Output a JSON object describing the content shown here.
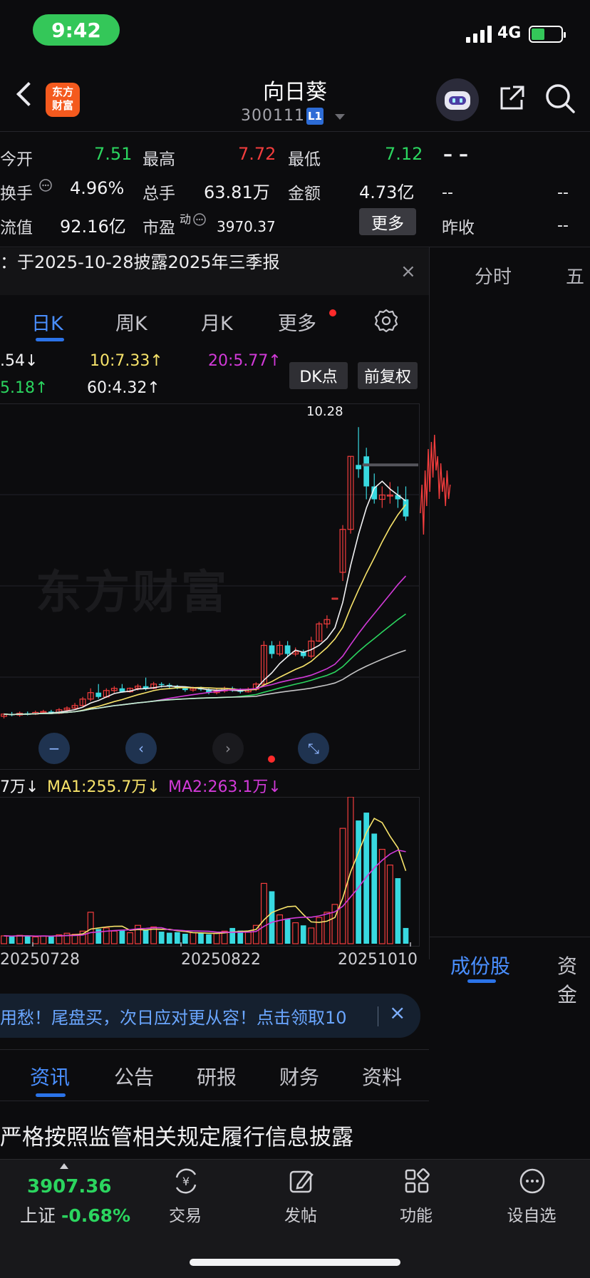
{
  "status": {
    "time": "9:42",
    "network": "4G"
  },
  "header": {
    "logo_text_1": "东方",
    "logo_text_2": "财富",
    "stock_name": "向日葵",
    "stock_code": "300111",
    "level_badge": "L1"
  },
  "quote": {
    "open_label": "今开",
    "open_value": "7.51",
    "high_label": "最高",
    "high_value": "7.72",
    "low_label": "最低",
    "low_value": "7.12",
    "turnover_label": "换手",
    "turnover_value": "4.96%",
    "volume_label": "总手",
    "volume_value": "63.81万",
    "amount_label": "金额",
    "amount_value": "4.73亿",
    "mktcap_label": "流值",
    "mktcap_value": "92.16亿",
    "pe_label": "市盈",
    "pe_sup": "动",
    "pe_value": "3970.37",
    "more_label": "更多",
    "side_dash": "– –",
    "side_r2a": "--",
    "side_r2b": "--",
    "prev_close_label": "昨收",
    "prev_close_value": "--"
  },
  "notice": {
    "text": "：于2025-10-28披露2025年三季报",
    "close": "×"
  },
  "right_tabs": {
    "time_share": "分时",
    "five": "五"
  },
  "kline_tabs": {
    "day": "日K",
    "week": "周K",
    "month": "月K",
    "more": "更多"
  },
  "ma_info": {
    "ma5": ".54↓",
    "ma10": "10:7.33↑",
    "ma20": "20:5.77↑",
    "ma30": "5.18↑",
    "ma60": "60:4.32↑"
  },
  "chips": {
    "dk": "DK点",
    "adjust": "前复权"
  },
  "chart_data": {
    "type": "candlestick",
    "watermark": "东方财富",
    "max_label": "10.28",
    "dates": [
      "20250728",
      "20250822",
      "20251010"
    ],
    "candles": [
      [
        3.55,
        3.6,
        3.5,
        3.62
      ],
      [
        3.6,
        3.58,
        3.55,
        3.65
      ],
      [
        3.58,
        3.62,
        3.54,
        3.66
      ],
      [
        3.62,
        3.6,
        3.57,
        3.66
      ],
      [
        3.6,
        3.64,
        3.58,
        3.68
      ],
      [
        3.64,
        3.66,
        3.6,
        3.7
      ],
      [
        3.66,
        3.62,
        3.6,
        3.7
      ],
      [
        3.62,
        3.7,
        3.6,
        3.74
      ],
      [
        3.7,
        3.74,
        3.66,
        3.78
      ],
      [
        3.74,
        3.8,
        3.72,
        3.86
      ],
      [
        3.8,
        3.95,
        3.78,
        4.0
      ],
      [
        3.95,
        4.1,
        3.9,
        4.2
      ],
      [
        4.1,
        4.0,
        3.96,
        4.3
      ],
      [
        4.0,
        4.15,
        3.98,
        4.2
      ],
      [
        4.15,
        4.2,
        4.1,
        4.25
      ],
      [
        4.2,
        4.12,
        4.1,
        4.3
      ],
      [
        4.12,
        4.2,
        4.1,
        4.22
      ],
      [
        4.2,
        4.25,
        4.15,
        4.3
      ],
      [
        4.25,
        4.2,
        4.15,
        4.45
      ],
      [
        4.2,
        4.3,
        4.18,
        4.35
      ],
      [
        4.3,
        4.28,
        4.22,
        4.34
      ],
      [
        4.28,
        4.24,
        4.2,
        4.32
      ],
      [
        4.24,
        4.2,
        4.18,
        4.28
      ],
      [
        4.2,
        4.16,
        4.12,
        4.24
      ],
      [
        4.16,
        4.2,
        4.12,
        4.24
      ],
      [
        4.2,
        4.18,
        4.14,
        4.24
      ],
      [
        4.18,
        4.1,
        4.06,
        4.22
      ],
      [
        4.1,
        4.14,
        4.06,
        4.2
      ],
      [
        4.14,
        4.2,
        4.1,
        4.24
      ],
      [
        4.2,
        4.16,
        4.12,
        4.24
      ],
      [
        4.16,
        4.12,
        4.08,
        4.2
      ],
      [
        4.12,
        4.18,
        4.1,
        4.22
      ],
      [
        4.18,
        4.3,
        4.14,
        4.34
      ],
      [
        4.3,
        5.2,
        4.28,
        5.3
      ],
      [
        5.2,
        5.0,
        4.9,
        5.3
      ],
      [
        5.0,
        5.2,
        4.95,
        5.3
      ],
      [
        5.2,
        5.0,
        4.95,
        5.3
      ],
      [
        5.0,
        5.05,
        4.95,
        5.15
      ],
      [
        5.05,
        4.95,
        4.9,
        5.1
      ],
      [
        4.95,
        5.3,
        4.9,
        5.4
      ],
      [
        5.3,
        5.7,
        5.28,
        5.75
      ],
      [
        5.7,
        5.8,
        5.6,
        5.9
      ],
      [
        6.3,
        6.3,
        6.3,
        6.3
      ],
      [
        6.9,
        7.9,
        6.7,
        8.0
      ],
      [
        7.9,
        9.6,
        7.8,
        9.6
      ],
      [
        9.4,
        9.3,
        9.1,
        10.28
      ],
      [
        9.6,
        8.9,
        8.6,
        9.8
      ],
      [
        8.9,
        8.6,
        8.5,
        9.2
      ],
      [
        8.6,
        8.7,
        8.4,
        8.9
      ],
      [
        8.7,
        8.7,
        8.5,
        9.0
      ],
      [
        8.7,
        8.6,
        8.4,
        8.9
      ],
      [
        8.6,
        8.2,
        8.1,
        8.9
      ]
    ]
  },
  "vol_info": {
    "vol": "7万↓",
    "ma1": "MA1:255.7万↓",
    "ma2": "MA2:263.1万↓"
  },
  "vol_data": [
    30,
    28,
    32,
    30,
    26,
    30,
    28,
    34,
    40,
    36,
    48,
    120,
    56,
    60,
    48,
    50,
    42,
    70,
    52,
    64,
    46,
    42,
    44,
    38,
    42,
    40,
    36,
    40,
    48,
    60,
    50,
    44,
    70,
    230,
    200,
    110,
    96,
    80,
    70,
    60,
    100,
    120,
    150,
    440,
    560,
    470,
    500,
    420,
    360,
    300,
    250,
    60
  ],
  "side_tabs": {
    "components": "成份股",
    "funds": "资金"
  },
  "ad": {
    "text": "用愁！尾盘买，次日应对更从容！点击领取10",
    "close": "×"
  },
  "news_tabs": {
    "news": "资讯",
    "announcement": "公告",
    "research": "研报",
    "finance": "财务",
    "profile": "资料"
  },
  "news_headline": "严格按照监管相关规定履行信息披露",
  "bottom": {
    "index_value": "3907.36",
    "index_name": "上证",
    "index_change": "-0.68%",
    "trade": "交易",
    "post": "发帖",
    "functions": "功能",
    "watchlist": "设自选"
  }
}
